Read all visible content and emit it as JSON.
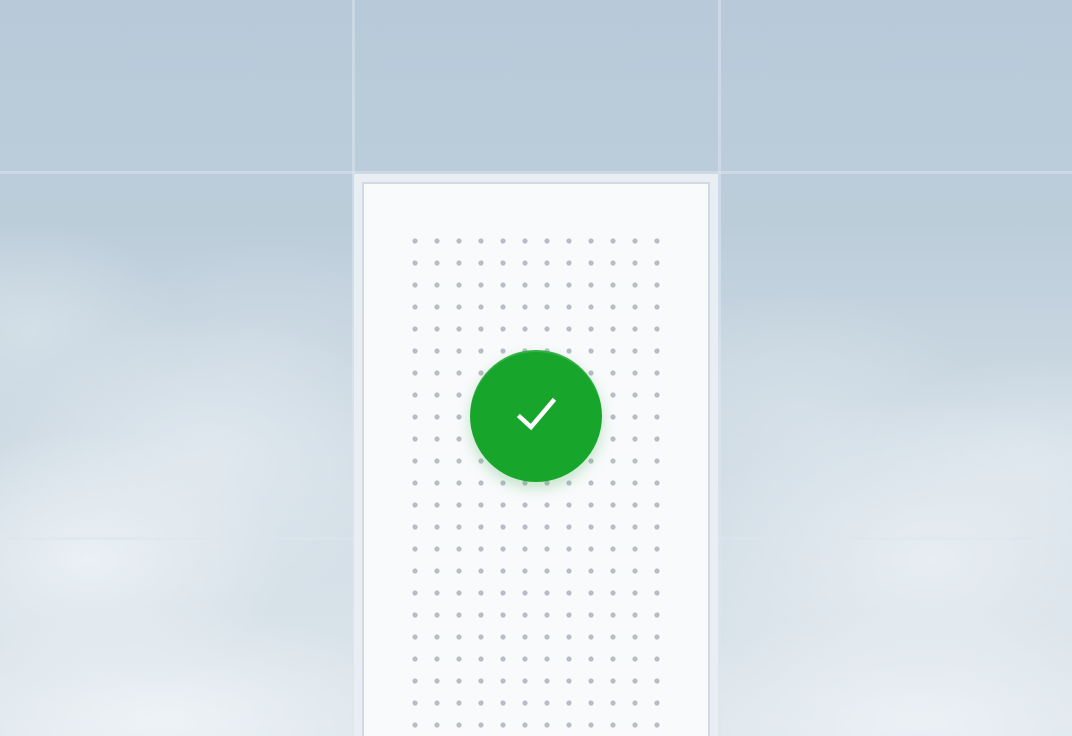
{
  "scene": {
    "background": "sky-with-clouds",
    "grid": {
      "columns": 3,
      "rows": 3
    }
  },
  "success_tile": {
    "status": "success",
    "icon": "checkmark-icon",
    "accent_color": "#18a52c",
    "pattern": "dot-grid"
  },
  "colors": {
    "sky": "#b9cad8",
    "card": "#f9fafc",
    "dot": "#b7bcc6"
  }
}
